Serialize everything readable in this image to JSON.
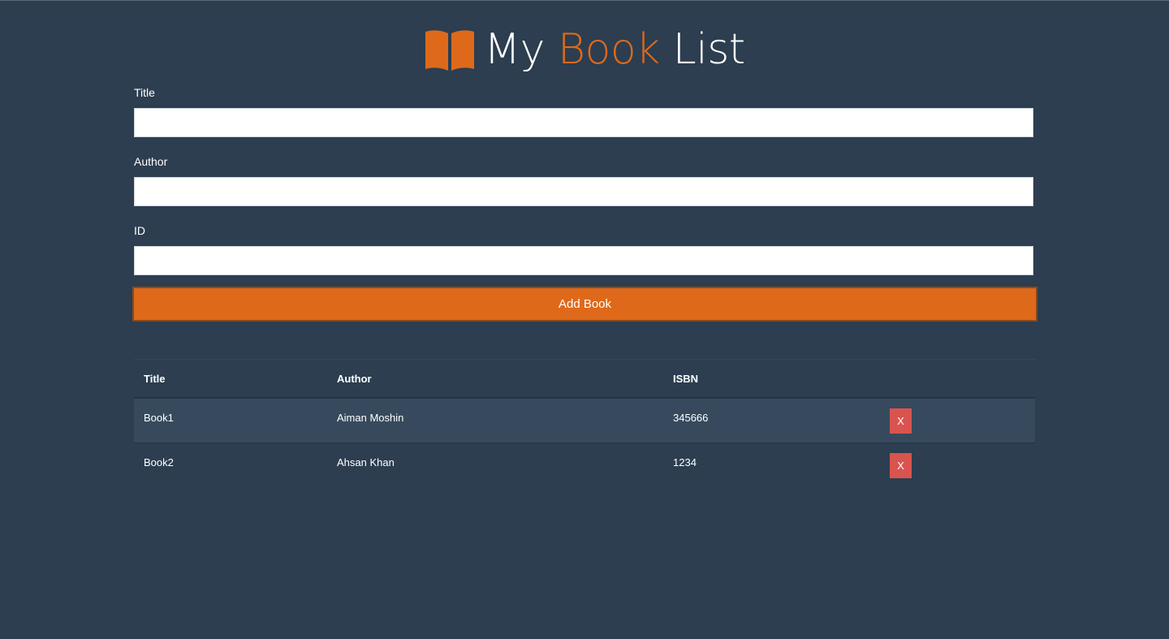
{
  "header": {
    "title_part1": "My",
    "title_accent": "Book",
    "title_part2": "List",
    "icon": "open-book-icon",
    "accent_color": "#df691a"
  },
  "form": {
    "title_label": "Title",
    "title_value": "",
    "author_label": "Author",
    "author_value": "",
    "id_label": "ID",
    "id_value": "",
    "submit_label": "Add Book"
  },
  "table": {
    "headers": [
      "Title",
      "Author",
      "ISBN",
      ""
    ],
    "rows": [
      {
        "title": "Book1",
        "author": "Aiman Moshin",
        "isbn": "345666",
        "delete_label": "X"
      },
      {
        "title": "Book2",
        "author": "Ahsan Khan",
        "isbn": "1234",
        "delete_label": "X"
      }
    ]
  },
  "colors": {
    "background": "#2c3e50",
    "accent": "#df691a",
    "danger": "#d9534f",
    "stripe": "#374a5d"
  }
}
